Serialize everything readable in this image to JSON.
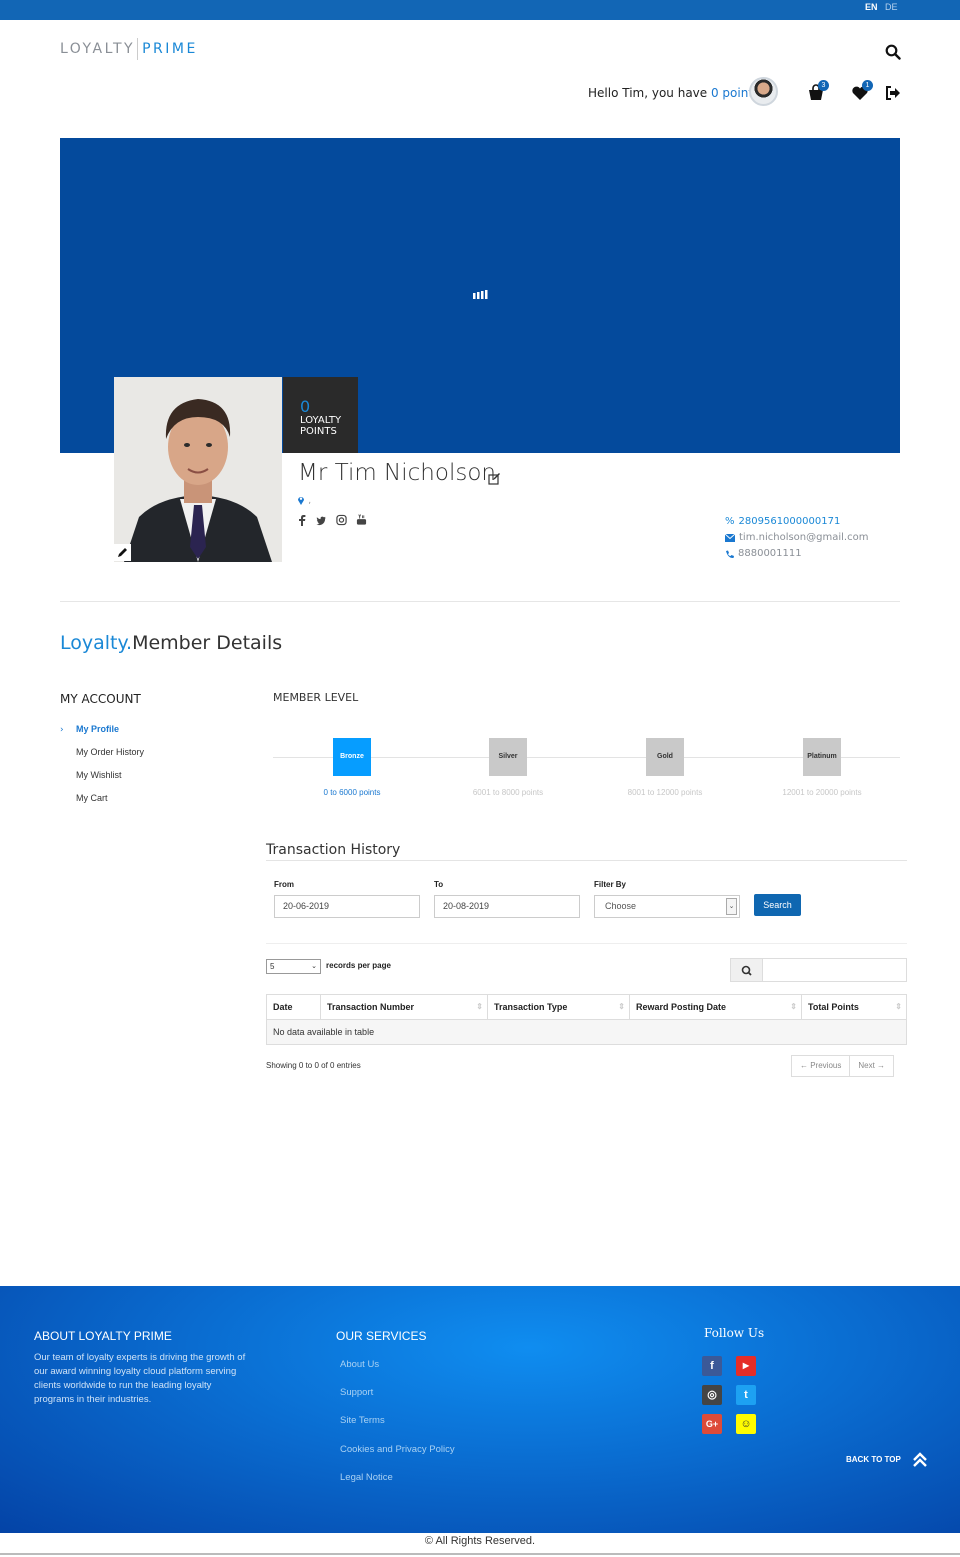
{
  "lang": {
    "en": "EN",
    "de": "DE"
  },
  "logo": {
    "part1": "LOYALTY",
    "part2": "PRIME"
  },
  "header": {
    "greeting_prefix": "Hello Tim, you have ",
    "points_link": "0 points",
    "cart_count": "3",
    "wishlist_count": "1"
  },
  "profile": {
    "points_value": "0",
    "points_label": "LOYALTY POINTS",
    "name": "Mr Tim Nicholson",
    "location": ",",
    "member_id": "2809561000000171",
    "email": "tim.nicholson@gmail.com",
    "phone": "8880001111"
  },
  "section": {
    "title_blue": "Loyalty.",
    "title_dark": "Member Details"
  },
  "sidebar": {
    "heading": "MY ACCOUNT",
    "items": [
      {
        "label": "My Profile",
        "active": true
      },
      {
        "label": "My Order History",
        "active": false
      },
      {
        "label": "My Wishlist",
        "active": false
      },
      {
        "label": "My Cart",
        "active": false
      }
    ]
  },
  "member_level": {
    "title": "MEMBER LEVEL",
    "levels": [
      {
        "name": "Bronze",
        "range": "0 to 6000 points",
        "current": true
      },
      {
        "name": "Silver",
        "range": "6001 to 8000 points",
        "current": false
      },
      {
        "name": "Gold",
        "range": "8001 to 12000 points",
        "current": false
      },
      {
        "name": "Platinum",
        "range": "12001 to 20000 points",
        "current": false
      }
    ]
  },
  "transactions": {
    "title": "Transaction History",
    "from_label": "From",
    "from_value": "20-06-2019",
    "to_label": "To",
    "to_value": "20-08-2019",
    "filter_label": "Filter By",
    "filter_value": "Choose",
    "search_button": "Search",
    "per_page_value": "5",
    "per_page_label": "records per page",
    "columns": [
      "Date",
      "Transaction Number",
      "Transaction Type",
      "Reward Posting Date",
      "Total Points"
    ],
    "empty_text": "No data available in table",
    "showing": "Showing 0 to 0 of 0 entries",
    "prev": "← Previous",
    "next": "Next →"
  },
  "footer": {
    "about_title": "ABOUT LOYALTY PRIME",
    "about_text": "Our team of loyalty experts is driving the growth of our award winning loyalty cloud platform serving clients worldwide to run the leading loyalty programs in their industries.",
    "services_title": "OUR SERVICES",
    "services": [
      "About Us",
      "Support",
      "Site Terms",
      "Cookies and Privacy Policy",
      "Legal Notice"
    ],
    "follow_title": "Follow Us",
    "social": [
      {
        "icon": "facebook-icon",
        "glyph": "f",
        "color": "#3b5998"
      },
      {
        "icon": "youtube-icon",
        "glyph": "▶",
        "color": "#e52d27"
      },
      {
        "icon": "instagram-icon",
        "glyph": "◎",
        "color": "#444444"
      },
      {
        "icon": "twitter-icon",
        "glyph": "t",
        "color": "#1da1f2"
      },
      {
        "icon": "google-plus-icon",
        "glyph": "G+",
        "color": "#dd4b39"
      },
      {
        "icon": "snapchat-icon",
        "glyph": "☺",
        "color": "#fffc00"
      }
    ],
    "back_to_top": "BACK TO TOP",
    "copyright": "© All Rights Reserved."
  },
  "colors": {
    "brand_blue": "#1266b5",
    "banner_blue": "#044a9c",
    "accent": "#1a88d6",
    "level_active": "#069dff"
  }
}
